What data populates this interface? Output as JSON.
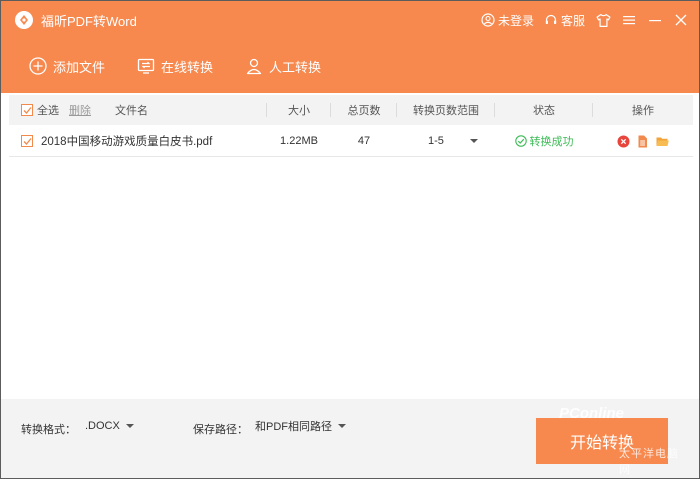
{
  "app": {
    "title": "福昕PDF转Word"
  },
  "titlebar": {
    "login": "未登录",
    "service": "客服"
  },
  "toolbar": {
    "add_file": "添加文件",
    "online_convert": "在线转换",
    "manual_convert": "人工转换"
  },
  "table": {
    "headers": {
      "select_all": "全选",
      "delete": "删除",
      "filename": "文件名",
      "size": "大小",
      "pages": "总页数",
      "range": "转换页数范围",
      "status": "状态",
      "ops": "操作"
    },
    "rows": [
      {
        "filename": "2018中国移动游戏质量白皮书.pdf",
        "size": "1.22MB",
        "pages": "47",
        "range": "1-5",
        "status": "转换成功"
      }
    ]
  },
  "bottom": {
    "format_label": "转换格式：",
    "format_value": ".DOCX",
    "path_label": "保存路径：",
    "path_value": "和PDF相同路径",
    "start_button": "开始转换"
  },
  "watermark": {
    "brand": "PConline",
    "sub": "太平洋电脑网"
  },
  "colors": {
    "accent": "#f7894f",
    "success": "#3dbb56",
    "danger": "#e8453c",
    "file": "#f28a4d",
    "folder": "#f2a33a"
  }
}
